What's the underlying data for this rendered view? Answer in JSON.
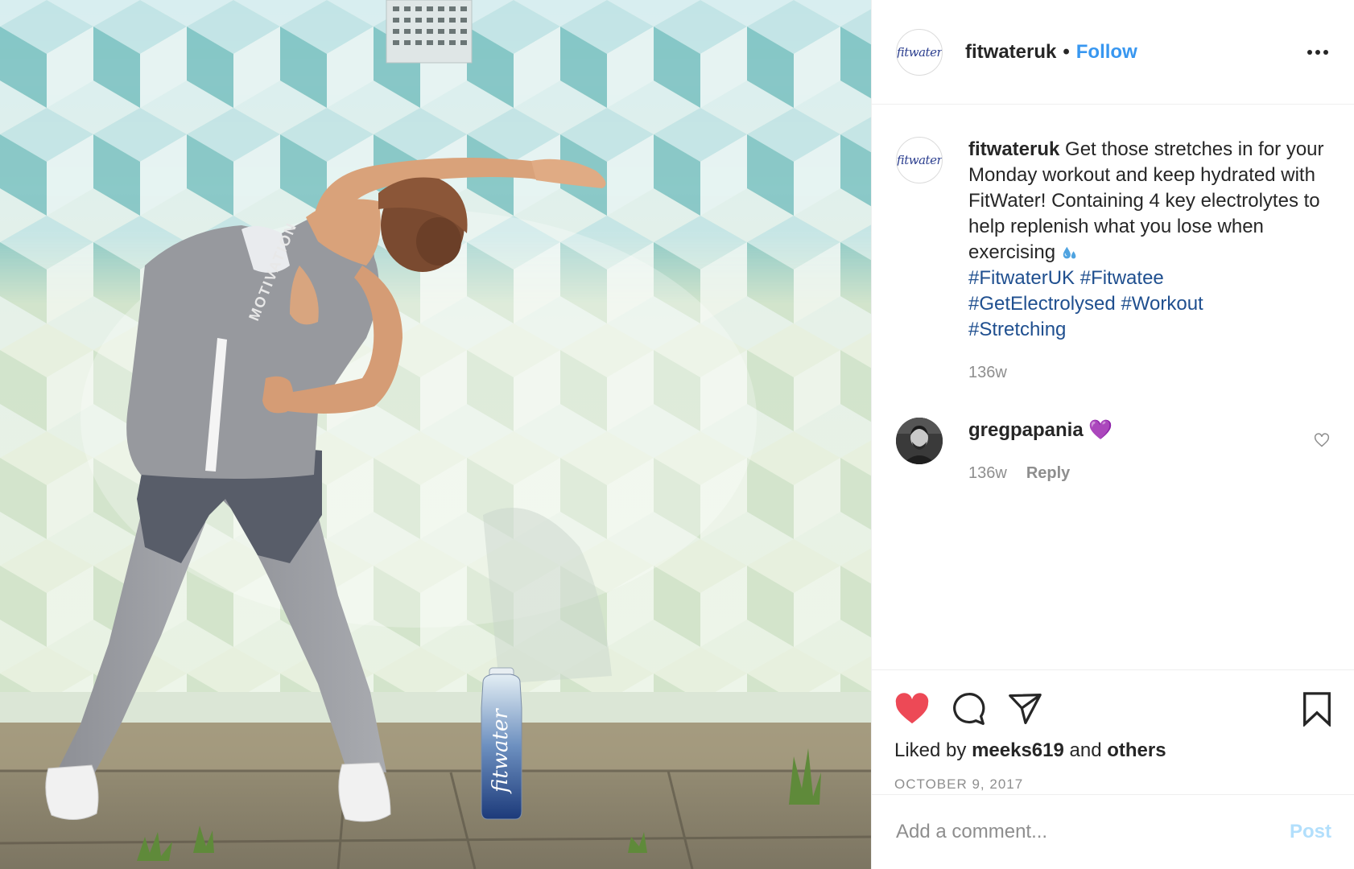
{
  "header": {
    "avatar_text": "fitwater",
    "username": "fitwateruk",
    "separator": "•",
    "follow_label": "Follow"
  },
  "caption": {
    "avatar_text": "fitwater",
    "username": "fitwateruk",
    "text": "Get those stretches in for your Monday workout and keep hydrated with FitWater! Containing 4 key electrolytes to help replenish what you lose when exercising",
    "hashtags": [
      "#FitwaterUK",
      "#Fitwatee",
      "#GetElectrolysed",
      "#Workout",
      "#Stretching"
    ],
    "time": "136w"
  },
  "comment": {
    "username": "gregpapania",
    "emoji": "💜",
    "time": "136w",
    "reply_label": "Reply"
  },
  "actions": {
    "liked_prefix": "Liked by",
    "liked_user": "meeks619",
    "liked_and": "and",
    "liked_others": "others",
    "date": "OCTOBER 9, 2017"
  },
  "add_comment": {
    "placeholder": "Add a comment...",
    "post_label": "Post"
  },
  "photo": {
    "bottle_label": "fitwater",
    "shirt_text": "MOTIVATION"
  },
  "colors": {
    "like_red": "#ed4956",
    "link_blue": "#3897f0",
    "hashtag_blue": "#1f4f8f",
    "post_disabled": "#b2dffc"
  },
  "icons": [
    "heart-filled-icon",
    "comment-icon",
    "share-icon",
    "bookmark-icon",
    "more-icon",
    "heart-outline-icon"
  ]
}
